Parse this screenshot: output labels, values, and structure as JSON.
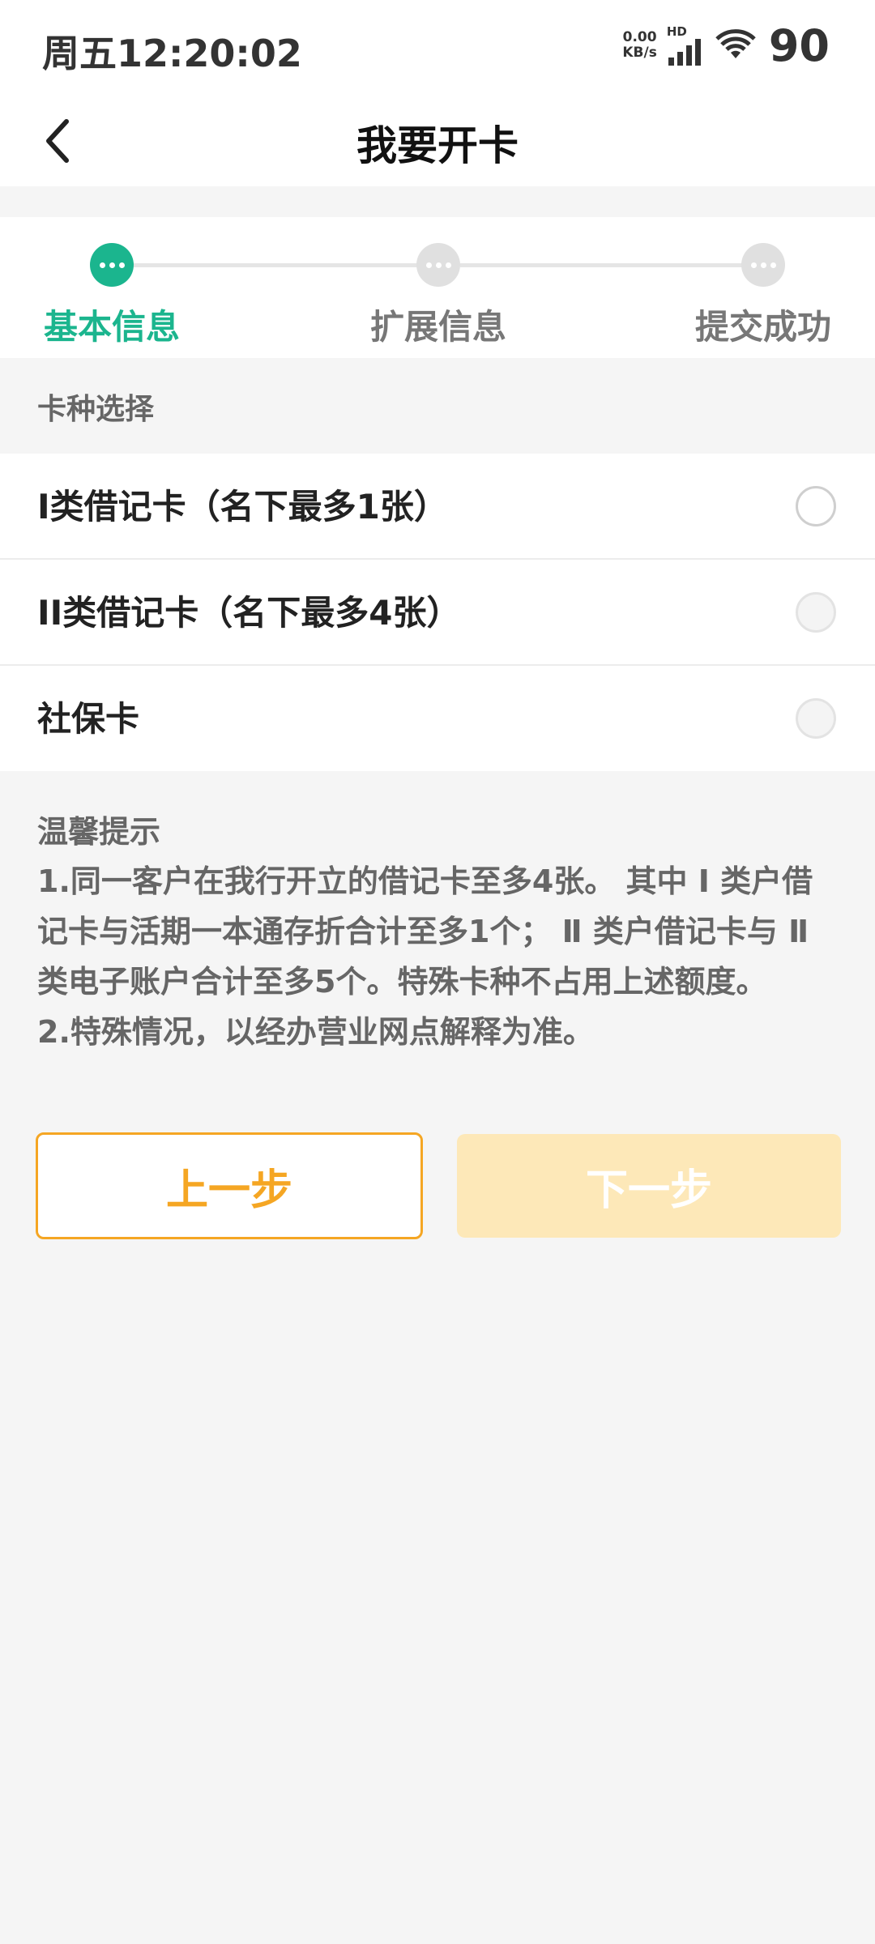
{
  "status_bar": {
    "time": "周五12:20:02",
    "net_speed_value": "0.00",
    "net_speed_unit": "KB/s",
    "hd_label": "HD",
    "battery": "90"
  },
  "nav": {
    "title": "我要开卡"
  },
  "steps": [
    {
      "label": "基本信息",
      "active": true
    },
    {
      "label": "扩展信息",
      "active": false
    },
    {
      "label": "提交成功",
      "active": false
    }
  ],
  "colors": {
    "accent_green": "#1bb58e",
    "inactive_gray": "#e0e0e0",
    "orange": "#f5a623",
    "orange_disabled": "#fde8b8"
  },
  "section": {
    "title": "卡种选择"
  },
  "card_options": [
    {
      "label": "I类借记卡（名下最多1张）",
      "enabled": true
    },
    {
      "label": "II类借记卡（名下最多4张）",
      "enabled": false
    },
    {
      "label": "社保卡",
      "enabled": false
    }
  ],
  "tips": {
    "title": "温馨提示",
    "lines": [
      "1.同一客户在我行开立的借记卡至多4张。 其中 Ⅰ 类户借",
      "记卡与活期一本通存折合计至多1个； Ⅱ 类户借记卡与 Ⅱ",
      "类电子账户合计至多5个。特殊卡种不占用上述额度。",
      "2.特殊情况，以经办营业网点解释为准。"
    ]
  },
  "buttons": {
    "prev": "上一步",
    "next": "下一步"
  }
}
